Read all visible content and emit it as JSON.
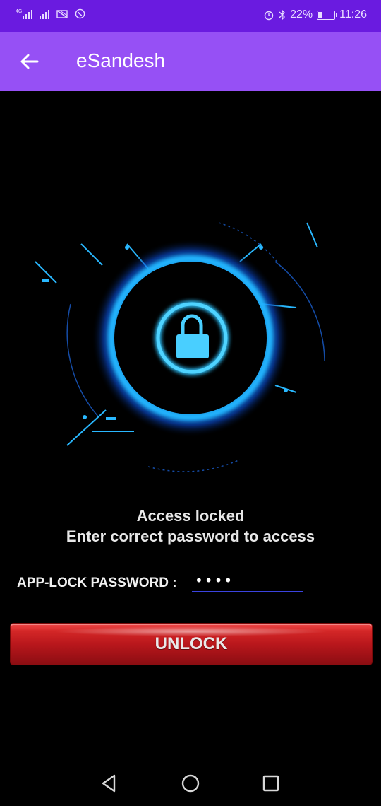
{
  "status_bar": {
    "network_1": "4G",
    "battery_percent": "22%",
    "time": "11:26",
    "icons": [
      "signal-icon",
      "wifi-off-icon",
      "whatsapp-icon",
      "alarm-icon",
      "bluetooth-icon",
      "battery-icon"
    ]
  },
  "app_bar": {
    "title": "eSandesh",
    "back_icon": "arrow-left-icon"
  },
  "hero": {
    "icon": "padlock-icon",
    "accent": "#18a8ff"
  },
  "message": {
    "line1": "Access locked",
    "line2": "Enter correct password to access"
  },
  "password": {
    "label": "APP-LOCK PASSWORD :",
    "value": "••••"
  },
  "unlock_button": {
    "label": "UNLOCK",
    "color": "#c41c22"
  },
  "nav_bar": {
    "icons": [
      "back-triangle-icon",
      "home-circle-icon",
      "recents-square-icon"
    ]
  },
  "colors": {
    "status_bar": "#6a1be0",
    "app_bar": "#9650f5",
    "field_line": "#3a43e0"
  }
}
